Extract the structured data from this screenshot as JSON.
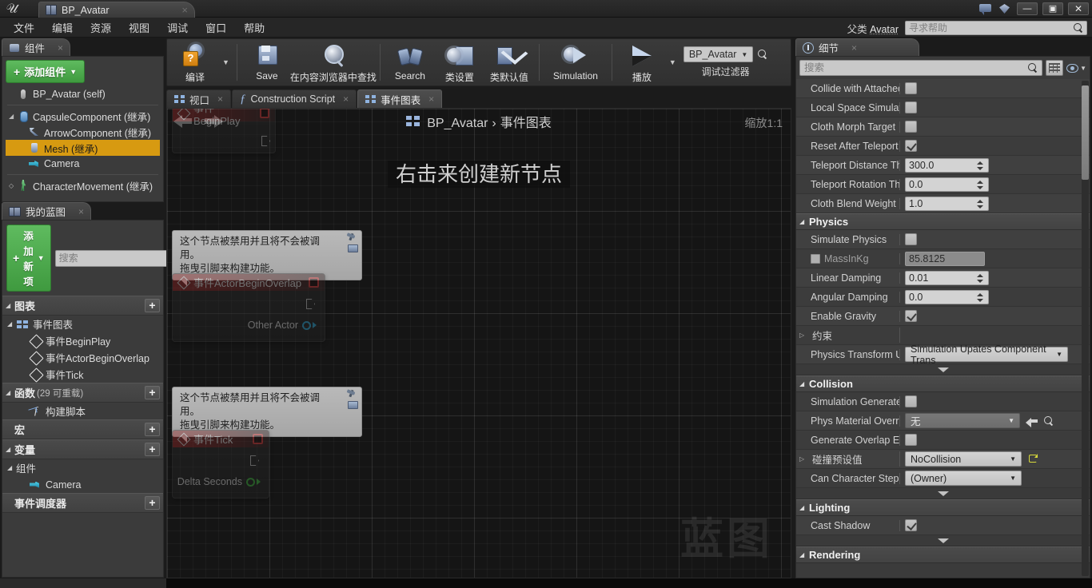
{
  "window": {
    "asset_tab": "BP_Avatar",
    "close_glyph": "×",
    "minimize": "—",
    "restore": "▣",
    "close": "✕"
  },
  "menu": {
    "items": [
      "文件",
      "编辑",
      "资源",
      "视图",
      "调试",
      "窗口",
      "帮助"
    ],
    "parent_class_label": "父类",
    "parent_class_value": "Avatar",
    "help_placeholder": "寻求帮助"
  },
  "toolbar": {
    "compile": "编译",
    "save": "Save",
    "find_in_cb": "在内容浏览器中查找",
    "search": "Search",
    "class_settings": "类设置",
    "class_defaults": "类默认值",
    "simulation": "Simulation",
    "play": "播放",
    "debug_filter_value": "BP_Avatar",
    "debug_filter_label": "调试过滤器"
  },
  "components_panel": {
    "tab_title": "组件",
    "add_button": "添加组件",
    "items": [
      {
        "label": "BP_Avatar (self)",
        "icon": "self-icon",
        "depth": 0,
        "selected": false,
        "arrow": ""
      },
      {
        "label": "CapsuleComponent (继承)",
        "icon": "capsule-icon",
        "depth": 0,
        "selected": false,
        "arrow": "◢"
      },
      {
        "label": "ArrowComponent (继承)",
        "icon": "arrow-component-icon",
        "depth": 1,
        "selected": false,
        "arrow": ""
      },
      {
        "label": "Mesh (继承)",
        "icon": "mesh-icon",
        "depth": 1,
        "selected": true,
        "arrow": ""
      },
      {
        "label": "Camera",
        "icon": "camera-icon",
        "depth": 1,
        "selected": false,
        "arrow": ""
      },
      {
        "label": "CharacterMovement (继承)",
        "icon": "character-movement-icon",
        "depth": 0,
        "selected": false,
        "arrow": "◇"
      }
    ]
  },
  "my_blueprint_panel": {
    "tab_title": "我的蓝图",
    "add_button": "添加新项",
    "search_placeholder": "搜索",
    "sections": [
      {
        "title": "图表",
        "sub": "",
        "arrow": "◢",
        "plus": "+",
        "rows": [
          {
            "label": "事件图表",
            "icon": "graph-icon",
            "depth": 0,
            "arrow": "◢"
          },
          {
            "label": "事件BeginPlay",
            "icon": "event-diamond-icon",
            "depth": 1,
            "arrow": ""
          },
          {
            "label": "事件ActorBeginOverlap",
            "icon": "event-diamond-icon",
            "depth": 1,
            "arrow": ""
          },
          {
            "label": "事件Tick",
            "icon": "event-diamond-icon",
            "depth": 1,
            "arrow": ""
          }
        ]
      },
      {
        "title": "函数",
        "sub": "(29 可重载)",
        "arrow": "◢",
        "plus": "+",
        "rows": [
          {
            "label": "构建脚本",
            "icon": "function-icon",
            "depth": 1,
            "arrow": ""
          }
        ]
      },
      {
        "title": "宏",
        "sub": "",
        "arrow": "",
        "plus": "+",
        "rows": []
      },
      {
        "title": "变量",
        "sub": "",
        "arrow": "◢",
        "plus": "+",
        "rows": [
          {
            "label": "组件",
            "icon": "",
            "depth": 0,
            "arrow": "◢"
          },
          {
            "label": "Camera",
            "icon": "camera-icon",
            "depth": 1,
            "arrow": ""
          }
        ]
      },
      {
        "title": "事件调度器",
        "sub": "",
        "arrow": "",
        "plus": "+",
        "rows": []
      }
    ]
  },
  "graph": {
    "tabs": [
      {
        "label": "视口",
        "icon": "viewport-icon",
        "active": false,
        "closable": true
      },
      {
        "label": "Construction Script",
        "icon": "function-fx-icon",
        "active": false,
        "closable": true
      },
      {
        "label": "事件图表",
        "icon": "graph-icon",
        "active": true,
        "closable": true
      }
    ],
    "breadcrumb_root": "BP_Avatar",
    "breadcrumb_sep": "›",
    "breadcrumb_leaf": "事件图表",
    "zoom_label": "缩放1:1",
    "hint": "右击来创建新节点",
    "watermark": "蓝图",
    "disabled_note_line1": "这个节点被禁用并且将不会被调用。",
    "disabled_note_line2": "拖曳引脚来构建功能。",
    "nodes": [
      {
        "title": "事件BeginPlay",
        "output_pin": "",
        "pin_color": ""
      },
      {
        "title": "事件ActorBeginOverlap",
        "output_pin": "Other Actor",
        "pin_color": "#2fa8d8"
      },
      {
        "title": "事件Tick",
        "output_pin": "Delta Seconds",
        "pin_color": "#3fb63f"
      }
    ]
  },
  "details_panel": {
    "tab_title": "细节",
    "search_placeholder": "搜索",
    "rows": [
      {
        "kind": "prop",
        "name": "Collide with Attached",
        "type": "checkbox",
        "value": false
      },
      {
        "kind": "prop",
        "name": "Local Space Simulat",
        "type": "checkbox",
        "value": false
      },
      {
        "kind": "prop",
        "name": "Cloth Morph Target",
        "type": "checkbox",
        "value": false
      },
      {
        "kind": "prop",
        "name": "Reset After Teleport",
        "type": "checkbox",
        "value": true
      },
      {
        "kind": "prop",
        "name": "Teleport Distance Th",
        "type": "number",
        "value": "300.0"
      },
      {
        "kind": "prop",
        "name": "Teleport Rotation Th",
        "type": "number",
        "value": "0.0"
      },
      {
        "kind": "prop",
        "name": "Cloth Blend Weight",
        "type": "number",
        "value": "1.0"
      },
      {
        "kind": "category",
        "name": "Physics",
        "arrow": "◢"
      },
      {
        "kind": "prop",
        "name": "Simulate Physics",
        "type": "checkbox",
        "value": false
      },
      {
        "kind": "prop",
        "name": "MassInKg",
        "type": "readonly",
        "value": "85.8125",
        "prefix_checkbox": true,
        "dim": true
      },
      {
        "kind": "prop",
        "name": "Linear Damping",
        "type": "number",
        "value": "0.01"
      },
      {
        "kind": "prop",
        "name": "Angular Damping",
        "type": "number",
        "value": "0.0"
      },
      {
        "kind": "prop",
        "name": "Enable Gravity",
        "type": "checkbox",
        "value": true
      },
      {
        "kind": "prop",
        "name": "约束",
        "type": "none",
        "value": "",
        "arrow": "▷"
      },
      {
        "kind": "prop",
        "name": "Physics Transform U",
        "type": "combo-wide",
        "value": "Simulation Upates Component Trans"
      },
      {
        "kind": "expander"
      },
      {
        "kind": "category",
        "name": "Collision",
        "arrow": "◢"
      },
      {
        "kind": "prop",
        "name": "Simulation Generate",
        "type": "checkbox",
        "value": false
      },
      {
        "kind": "prop",
        "name": "Phys Material Overri",
        "type": "combo-dark",
        "value": "无",
        "has_back": true,
        "has_search": true
      },
      {
        "kind": "prop",
        "name": "Generate Overlap Ev",
        "type": "checkbox",
        "value": false
      },
      {
        "kind": "prop",
        "name": "碰撞预设值",
        "type": "combo-med",
        "value": "NoCollision",
        "arrow": "▷",
        "has_revert": true
      },
      {
        "kind": "prop",
        "name": "Can Character Step U",
        "type": "combo-med",
        "value": "(Owner)"
      },
      {
        "kind": "expander"
      },
      {
        "kind": "category",
        "name": "Lighting",
        "arrow": "◢"
      },
      {
        "kind": "prop",
        "name": "Cast Shadow",
        "type": "checkbox",
        "value": true
      },
      {
        "kind": "expander"
      },
      {
        "kind": "category",
        "name": "Rendering",
        "arrow": "◢"
      }
    ]
  }
}
